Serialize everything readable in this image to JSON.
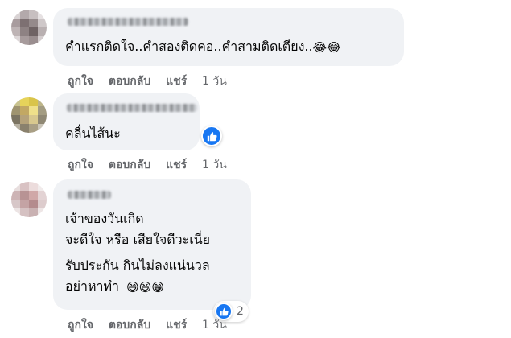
{
  "comments": [
    {
      "text_lines": [
        "คำแรกติดใจ..คำสองติดคอ..คำสามติดเตียง.."
      ],
      "emojis": "😂😂",
      "actions": {
        "like": "ถูกใจ",
        "reply": "ตอบกลับ",
        "share": "แชร์",
        "time": "1 วัน"
      }
    },
    {
      "text_lines": [
        "คลื่นไส้นะ"
      ],
      "reaction_icon": "like-icon",
      "actions": {
        "like": "ถูกใจ",
        "reply": "ตอบกลับ",
        "share": "แชร์",
        "time": "1 วัน"
      }
    },
    {
      "text_lines": [
        "เจ้าของวันเกิด",
        "จะดีใจ หรือ เสียใจดีวะเนี่ย",
        "รับประกัน กินไม่ลงแน่นวล",
        "อย่าหาทำ"
      ],
      "emojis": "😄😆😁",
      "reaction_icon": "like-icon",
      "reaction_count": "2",
      "actions": {
        "like": "ถูกใจ",
        "reply": "ตอบกลับ",
        "share": "แชร์",
        "time": "1 วัน"
      }
    }
  ],
  "colors": {
    "bubble": "#f0f2f5",
    "action_text": "#65676b",
    "like_blue": "#1877f2"
  }
}
